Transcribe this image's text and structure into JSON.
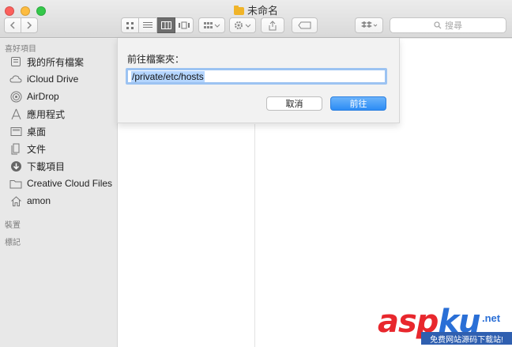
{
  "window": {
    "title": "未命名"
  },
  "toolbar": {
    "search_placeholder": "搜尋"
  },
  "sidebar": {
    "favorites_heading": "喜好項目",
    "devices_heading": "裝置",
    "tags_heading": "標記",
    "items": [
      {
        "label": "我的所有檔案",
        "icon": "all-files-icon"
      },
      {
        "label": "iCloud Drive",
        "icon": "cloud-icon"
      },
      {
        "label": "AirDrop",
        "icon": "airdrop-icon"
      },
      {
        "label": "應用程式",
        "icon": "applications-icon"
      },
      {
        "label": "桌面",
        "icon": "desktop-icon"
      },
      {
        "label": "文件",
        "icon": "documents-icon"
      },
      {
        "label": "下載項目",
        "icon": "downloads-icon"
      },
      {
        "label": "Creative Cloud Files",
        "icon": "folder-icon"
      },
      {
        "label": "amon",
        "icon": "home-icon"
      }
    ]
  },
  "goto_sheet": {
    "label": "前往檔案夾：",
    "path_value": "/private/etc/hosts",
    "cancel_label": "取消",
    "go_label": "前往"
  },
  "watermark": {
    "asp": "asp",
    "ku": "ku",
    "net": ".net",
    "subtitle": "免费网站源码下载站!"
  },
  "colors": {
    "accent": "#2c8cf5",
    "selection": "#b4d5fe",
    "watermark_red": "#e8272d",
    "watermark_blue": "#2a6fd6"
  }
}
